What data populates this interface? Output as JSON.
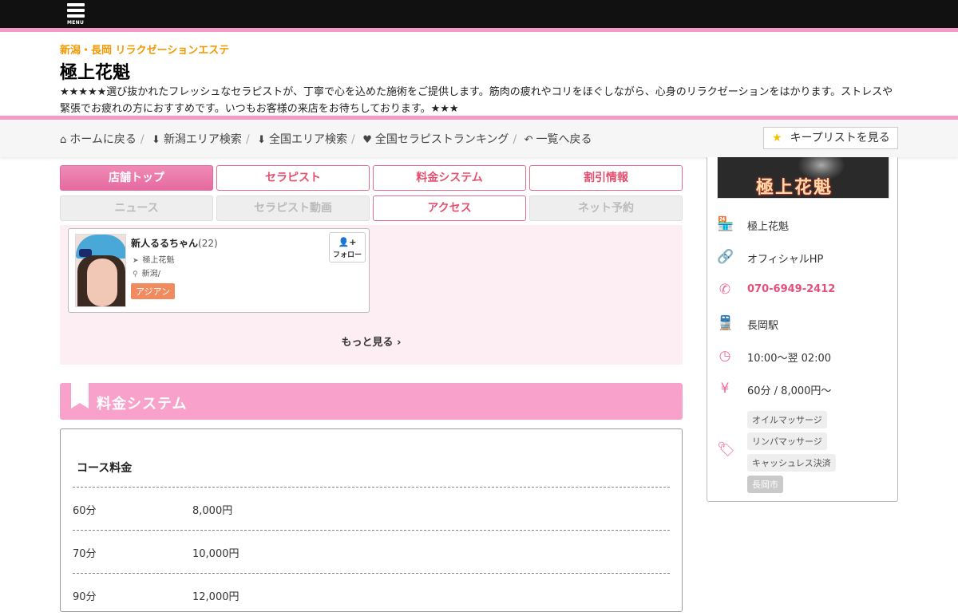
{
  "topbar": {
    "menu_label": "MENU"
  },
  "header": {
    "subtitle": "新潟・長岡 リラクゼーションエステ",
    "title": "極上花魁",
    "description": "★★★★★選び抜かれたフレッシュなセラピストが、丁寧で心を込めた施術をご提供します。筋肉の疲れやコリをほぐしながら、心身のリラクゼーションをはかります。ストレスや緊張でお疲れの方におすすめです。いつもお客様の来店をお待ちしております。★★★"
  },
  "breadcrumbs": [
    {
      "label": "ホームに戻る",
      "icon": "home-icon"
    },
    {
      "label": "新潟エリア検索",
      "icon": "arrow-down-icon"
    },
    {
      "label": "全国エリア検索",
      "icon": "arrow-down-icon"
    },
    {
      "label": "全国セラピストランキング",
      "icon": "heart-icon"
    },
    {
      "label": "一覧へ戻る",
      "icon": "reply-icon"
    }
  ],
  "keep_button": {
    "label": "キープリストを見る",
    "icon": "star-icon"
  },
  "tabs": [
    {
      "label": "店舗トップ",
      "state": "active"
    },
    {
      "label": "セラピスト",
      "state": "normal"
    },
    {
      "label": "料金システム",
      "state": "normal"
    },
    {
      "label": "割引情報",
      "state": "normal"
    },
    {
      "label": "ニュース",
      "state": "disabled"
    },
    {
      "label": "セラピスト動画",
      "state": "disabled"
    },
    {
      "label": "アクセス",
      "state": "normal"
    },
    {
      "label": "ネット予約",
      "state": "disabled"
    }
  ],
  "therapist": {
    "name": "新人るるちゃん",
    "age": "(22)",
    "shop": "極上花魁",
    "area": "新潟/",
    "tag": "アジアン",
    "follow_label": "フォロー"
  },
  "more_label": "もっと見る",
  "pricing": {
    "section_title": "料金システム",
    "course_title": "コース料金",
    "rows": [
      {
        "duration": "60分",
        "price": "8,000円"
      },
      {
        "duration": "70分",
        "price": "10,000円"
      },
      {
        "duration": "90分",
        "price": "12,000円"
      }
    ]
  },
  "sidebar": {
    "logo_text": "極上花魁",
    "shop_name": "極上花魁",
    "official_hp": "オフィシャルHP",
    "phone": "070-6949-2412",
    "station": "長岡駅",
    "hours": "10:00～翌 02:00",
    "price": "60分 / 8,000円～",
    "tags": [
      "オイルマッサージ",
      "リンパマッサージ",
      "キャッシュレス決済",
      "長岡市"
    ]
  },
  "colors": {
    "accent_pink": "#f39ac7",
    "tab_red": "#e4506f",
    "subtitle_orange": "#f39800",
    "section_pink": "#f8a2cb"
  }
}
